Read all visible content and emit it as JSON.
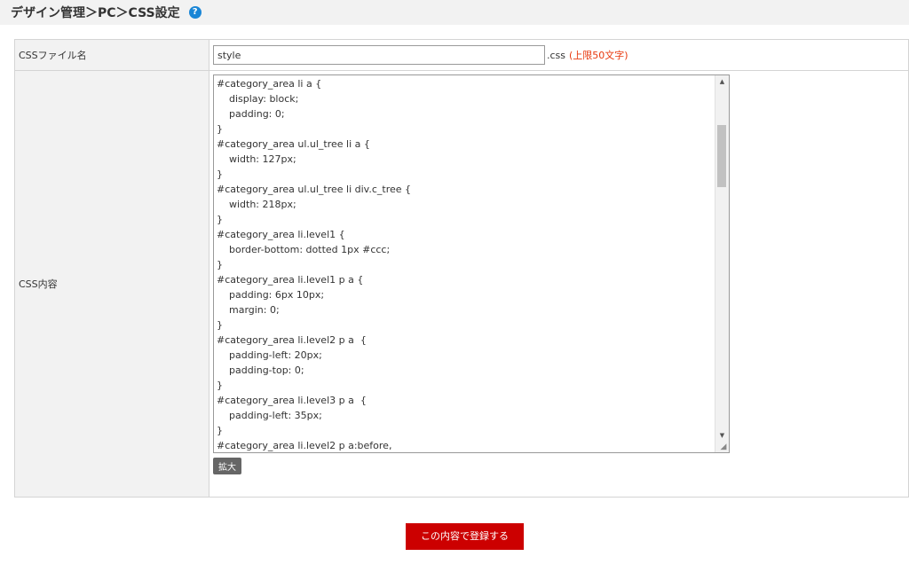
{
  "header": {
    "breadcrumb": "デザイン管理＞PC＞CSS設定",
    "help_icon": "?"
  },
  "form": {
    "filename_label": "CSSファイル名",
    "filename_value": "style",
    "filename_ext": ".css",
    "filename_limit": "(上限50文字)",
    "content_label": "CSS内容",
    "code_lines": [
      "#category_area li a {",
      "    display: block;",
      "    padding: 0;",
      "}",
      "#category_area ul.ul_tree li a {",
      "    width: 127px;",
      "}",
      "#category_area ul.ul_tree li div.c_tree {",
      "    width: 218px;",
      "}",
      "#category_area li.level1 {",
      "    border-bottom: dotted 1px #ccc;",
      "}",
      "#category_area li.level1 p a {",
      "    padding: 6px 10px;",
      "    margin: 0;",
      "}",
      "#category_area li.level2 p a  {",
      "    padding-left: 20px;",
      "    padding-top: 0;",
      "}",
      "#category_area li.level3 p a  {",
      "    padding-left: 35px;",
      "}",
      "#category_area li.level2 p a:before,"
    ],
    "expand_label": "拡大",
    "submit_label": "この内容で登録する"
  },
  "colors": {
    "submit_bg": "#cc0000",
    "limit_text": "#e8380d",
    "help_icon_bg": "#1a86d6"
  },
  "icons": {
    "help": "question-circle-icon",
    "scroll_up": "triangle-up-icon",
    "scroll_down": "triangle-down-icon",
    "resize": "resize-grip-icon"
  }
}
